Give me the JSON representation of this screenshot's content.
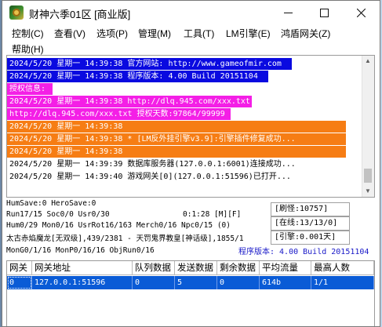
{
  "window": {
    "title": "财神六季01区 [商业版]",
    "controls": {
      "minimize": "minimize-icon",
      "maximize": "maximize-icon",
      "close": "close-icon"
    }
  },
  "menu": {
    "items": [
      {
        "label": "控制(C)"
      },
      {
        "label": "查看(V)"
      },
      {
        "label": "选项(P)"
      },
      {
        "label": "管理(M)"
      },
      {
        "label": "工具(T)"
      },
      {
        "label": "LM引擎(E)"
      },
      {
        "label": "鸿盾网关(Z)"
      },
      {
        "label": "帮助(H)"
      }
    ]
  },
  "log": {
    "lines": [
      {
        "text": "2024/5/20 星期一 14:39:38 官方网站: http://www.gameofmir.com",
        "style": "blue"
      },
      {
        "text": "2024/5/20 星期一 14:39:38 程序版本: 4.00 Build 20151104",
        "style": "blue"
      },
      {
        "text": "授权信息:",
        "style": "magenta"
      },
      {
        "text": "2024/5/20 星期一 14:39:38 http://dlq.945.com/xxx.txt",
        "style": "magenta"
      },
      {
        "text": "http://dlq.945.com/xxx.txt 授权天数:97864/99999",
        "style": "magenta"
      },
      {
        "text": "2024/5/20 星期一 14:39:38",
        "style": "orange"
      },
      {
        "text": "2024/5/20 星期一 14:39:38 * [LM反外挂引擎v3.9]:引擎插件修复成功...",
        "style": "orange"
      },
      {
        "text": "2024/5/20 星期一 14:39:38",
        "style": "orange"
      },
      {
        "text": "2024/5/20 星期一 14:39:39 数据库服务器(127.0.0.1:6001)连接成功...",
        "style": "white"
      },
      {
        "text": "2024/5/20 星期一 14:39:40 游戏网关[0](127.0.0.1:51596)已打开...",
        "style": "white"
      }
    ]
  },
  "status": {
    "line1": "HumSave:0 HeroSave:0",
    "line2": "Run17/15 Soc0/0 Usr0/30",
    "line2_time": "0:1:28 [M][F]",
    "line3": "Hum0/29 Mon0/16 UsrRot16/163 Merch0/16 Npc0/15 (0)",
    "line4": "太古赤焰魔龙[无双级],439/2381 - 天罚鬼界教皇[神话级],1855/1",
    "line5": "MonG0/1/16 MonP0/16/16 ObjRun0/16",
    "refresh": "[刷怪:10757]",
    "online": "[在线:13/13/0]",
    "engine": "[引擎:0.001天]",
    "version": "程序版本: 4.00 Build 20151104"
  },
  "gateway_table": {
    "columns": [
      "网关",
      "网关地址",
      "队列数据",
      "发送数据",
      "剩余数据",
      "平均流量",
      "最高人数"
    ],
    "rows": [
      [
        "0",
        "127.0.0.1:51596",
        "0",
        "5",
        "0",
        "614b",
        "1/1"
      ]
    ]
  },
  "colors": {
    "log_blue": "#0a0ae0",
    "log_magenta": "#f41fe6",
    "log_orange": "#f67d14",
    "selection": "#0a5bd6",
    "version_text": "#1818c8"
  }
}
